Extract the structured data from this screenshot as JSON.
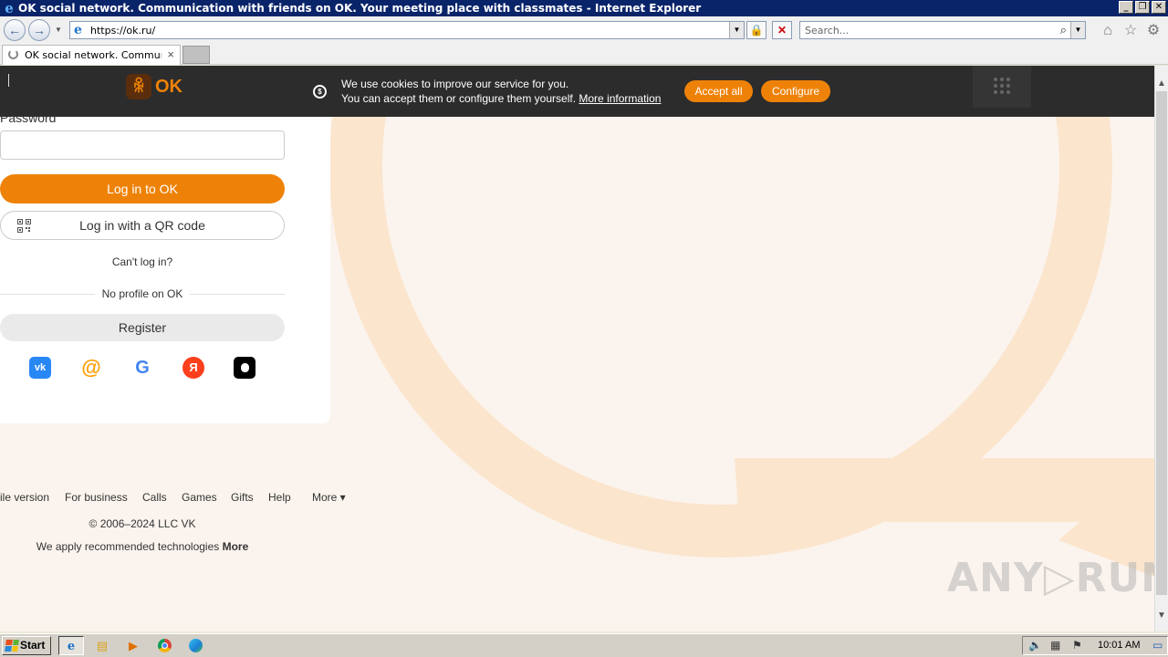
{
  "window": {
    "title": "OK social network. Communication with friends on OK. Your meeting place with classmates - Internet Explorer",
    "minimize_glyph": "_",
    "restore_glyph": "❐",
    "close_glyph": "✕"
  },
  "navbar": {
    "url": "https://ok.ru/",
    "search_placeholder": "Search..."
  },
  "tabs": [
    {
      "label": "OK social network. Communi..."
    }
  ],
  "cookie_banner": {
    "line1": "We use cookies to improve our service for you.",
    "line2": "You can accept them or configure them yourself.",
    "more_link": "More information",
    "accept_label": "Accept all",
    "configure_label": "Configure"
  },
  "logo": {
    "mark": "ꆜ",
    "text": "OK"
  },
  "login": {
    "password_label": "Password",
    "login_button": "Log in to OK",
    "qr_button": "Log in with a QR code",
    "cant_login": "Can't log in?",
    "no_profile": "No profile on OK",
    "register_button": "Register"
  },
  "social_logins": [
    {
      "name": "vk",
      "glyph": "vk",
      "color": "#2787f5"
    },
    {
      "name": "mail",
      "glyph": "@",
      "color": "#ff9e00"
    },
    {
      "name": "google",
      "glyph": "G",
      "color": "#ffffff"
    },
    {
      "name": "yandex",
      "glyph": "Я",
      "color": "#fc3f1d"
    },
    {
      "name": "apple",
      "glyph": "",
      "color": "#000000"
    }
  ],
  "footer": {
    "links": [
      "ile version",
      "For business",
      "Calls",
      "Games",
      "Gifts",
      "Help",
      "More ▾"
    ],
    "copyright": "© 2006–2024 LLC VK",
    "tech_text": "We apply recommended technologies ",
    "tech_more": "More"
  },
  "watermark": "ANY▷RUN",
  "taskbar": {
    "start_label": "Start",
    "clock": "10:01 AM"
  },
  "colors": {
    "ok_orange": "#ee8208",
    "banner_bg": "#2c2c2c",
    "page_bg": "#fbf4ee",
    "ie_titlebar": "#0a246a"
  }
}
